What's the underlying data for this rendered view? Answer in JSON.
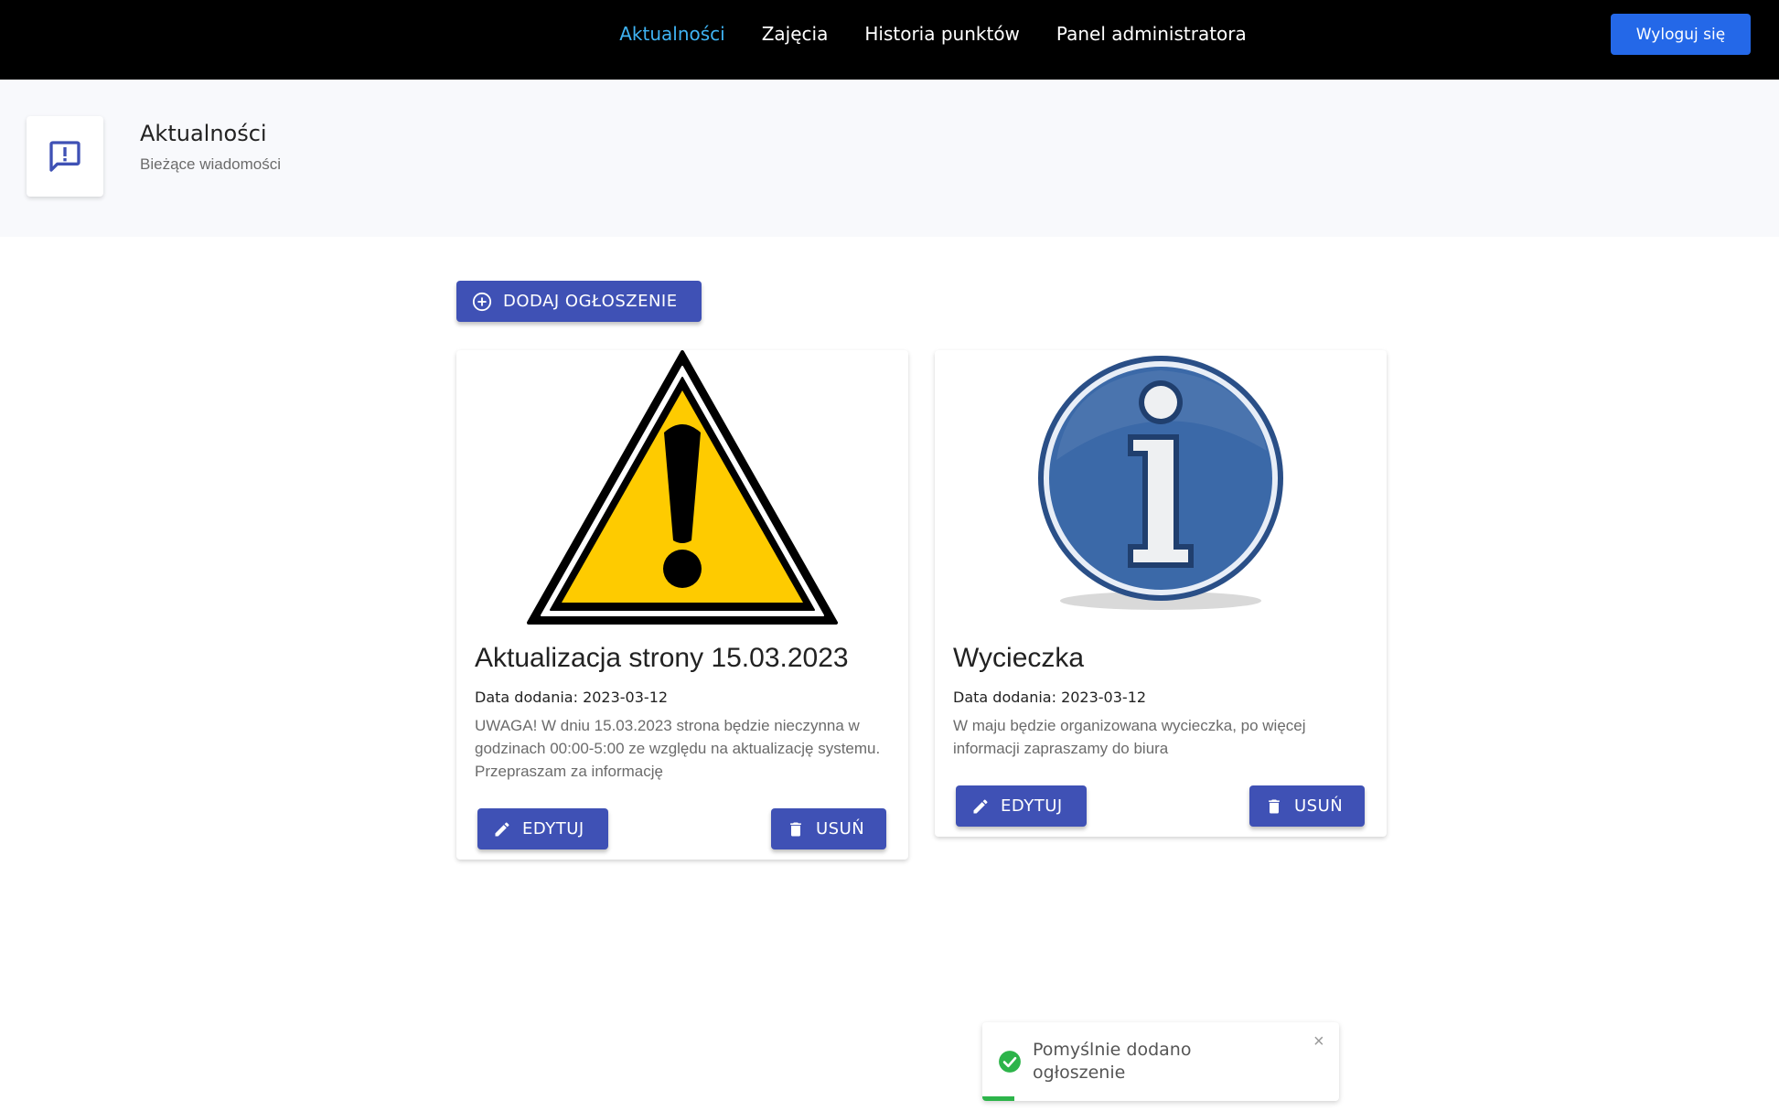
{
  "nav": {
    "links": [
      "Aktualności",
      "Zajęcia",
      "Historia punktów",
      "Panel administratora"
    ],
    "logout_label": "Wyloguj się"
  },
  "header": {
    "title": "Aktualności",
    "subtitle": "Bieżące wiadomości",
    "icon": "announcement-icon"
  },
  "add_button_label": "DODAJ OGŁOSZENIE",
  "cards": [
    {
      "image": "warning-sign",
      "title": "Aktualizacja strony 15.03.2023",
      "date": "Data dodania: 2023-03-12",
      "text": "UWAGA! W dniu 15.03.2023 strona będzie nieczynna w godzinach 00:00-5:00 ze względu na aktualizację systemu. Przepraszam za informację",
      "edit_label": "EDYTUJ",
      "delete_label": "USUŃ"
    },
    {
      "image": "info-sign",
      "title": "Wycieczka",
      "date": "Data dodania: 2023-03-12",
      "text": "W maju będzie organizowana wycieczka, po więcej informacji zapraszamy do biura",
      "edit_label": "EDYTUJ",
      "delete_label": "USUŃ"
    }
  ],
  "toast": {
    "message": "Pomyślnie dodano ogłoszenie",
    "close": "×",
    "progress": 0.09
  },
  "colors": {
    "primary": "#3f51b5",
    "logout": "#2468e8",
    "nav_active": "#3fb3f3",
    "success": "#2db44a"
  }
}
